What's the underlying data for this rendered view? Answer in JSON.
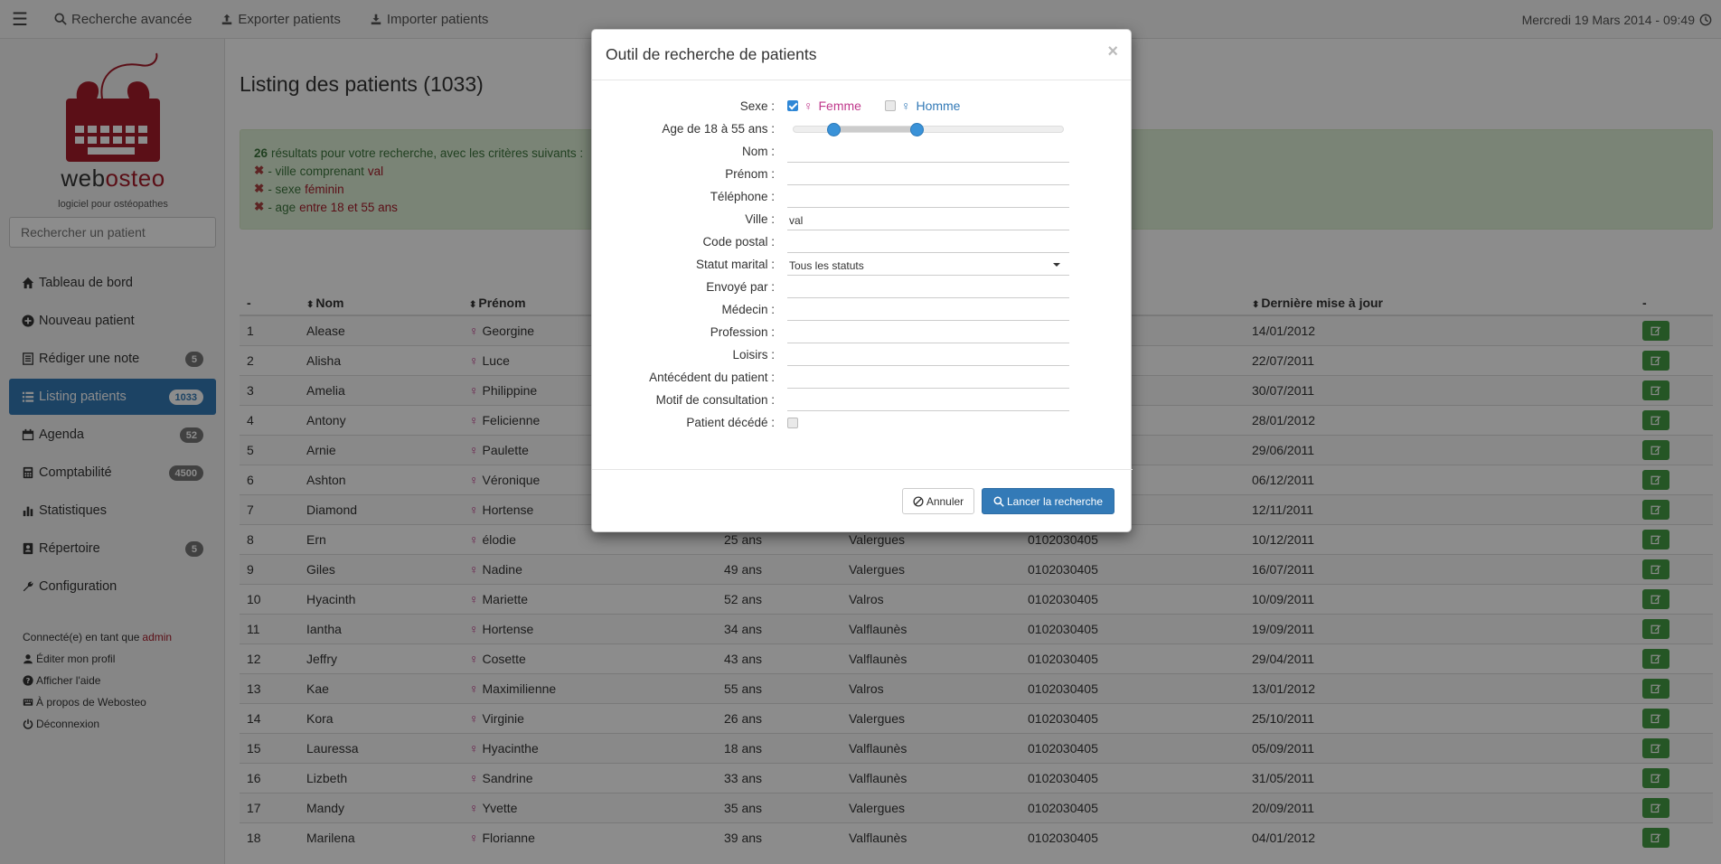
{
  "topbar": {
    "advanced_search": "Recherche avancée",
    "export": "Exporter patients",
    "import": "Importer patients",
    "datetime": "Mercredi 19 Mars 2014 - 09:49"
  },
  "sidebar": {
    "brand_left": "web",
    "brand_right": "osteo",
    "tagline": "logiciel pour ostéopathes",
    "search_placeholder": "Rechercher un patient",
    "items": [
      {
        "label": "Tableau de bord",
        "badge": ""
      },
      {
        "label": "Nouveau patient",
        "badge": ""
      },
      {
        "label": "Rédiger une note",
        "badge": "5"
      },
      {
        "label": "Listing patients",
        "badge": "1033"
      },
      {
        "label": "Agenda",
        "badge": "52"
      },
      {
        "label": "Comptabilité",
        "badge": "4500"
      },
      {
        "label": "Statistiques",
        "badge": ""
      },
      {
        "label": "Répertoire",
        "badge": "5"
      },
      {
        "label": "Configuration",
        "badge": ""
      }
    ],
    "account": {
      "connected_as": "Connecté(e) en tant que",
      "user": "admin",
      "edit_profile": "Éditer mon profil",
      "help": "Afficher l'aide",
      "about": "À propos de Webosteo",
      "logout": "Déconnexion"
    }
  },
  "main": {
    "title": "Listing des patients (1033)",
    "alert": {
      "count": "26",
      "intro": "résultats pour votre recherche, avec les critères suivants :",
      "criteria": [
        {
          "prefix": "- ville comprenant",
          "value": "val"
        },
        {
          "prefix": "- sexe",
          "value": "féminin"
        },
        {
          "prefix": "- age",
          "value": "entre 18 et 55 ans"
        }
      ]
    },
    "columns": [
      "-",
      "Nom",
      "Prénom",
      "Dernière mise à jour",
      "-"
    ],
    "rows": [
      {
        "n": "1",
        "nom": "Alease",
        "prenom": "Georgine",
        "age": "",
        "ville": "",
        "tel": "",
        "maj": "14/01/2012"
      },
      {
        "n": "2",
        "nom": "Alisha",
        "prenom": "Luce",
        "age": "",
        "ville": "",
        "tel": "",
        "maj": "22/07/2011"
      },
      {
        "n": "3",
        "nom": "Amelia",
        "prenom": "Philippine",
        "age": "",
        "ville": "",
        "tel": "",
        "maj": "30/07/2011"
      },
      {
        "n": "4",
        "nom": "Antony",
        "prenom": "Felicienne",
        "age": "",
        "ville": "",
        "tel": "",
        "maj": "28/01/2012"
      },
      {
        "n": "5",
        "nom": "Arnie",
        "prenom": "Paulette",
        "age": "",
        "ville": "",
        "tel": "",
        "maj": "29/06/2011"
      },
      {
        "n": "6",
        "nom": "Ashton",
        "prenom": "Véronique",
        "age": "",
        "ville": "",
        "tel": "",
        "maj": "06/12/2011"
      },
      {
        "n": "7",
        "nom": "Diamond",
        "prenom": "Hortense",
        "age": "",
        "ville": "",
        "tel": "",
        "maj": "12/11/2011"
      },
      {
        "n": "8",
        "nom": "Ern",
        "prenom": "élodie",
        "age": "25 ans",
        "ville": "Valergues",
        "tel": "0102030405",
        "maj": "10/12/2011"
      },
      {
        "n": "9",
        "nom": "Giles",
        "prenom": "Nadine",
        "age": "49 ans",
        "ville": "Valergues",
        "tel": "0102030405",
        "maj": "16/07/2011"
      },
      {
        "n": "10",
        "nom": "Hyacinth",
        "prenom": "Mariette",
        "age": "52 ans",
        "ville": "Valros",
        "tel": "0102030405",
        "maj": "10/09/2011"
      },
      {
        "n": "11",
        "nom": "Iantha",
        "prenom": "Hortense",
        "age": "34 ans",
        "ville": "Valflaunès",
        "tel": "0102030405",
        "maj": "19/09/2011"
      },
      {
        "n": "12",
        "nom": "Jeffry",
        "prenom": "Cosette",
        "age": "43 ans",
        "ville": "Valflaunès",
        "tel": "0102030405",
        "maj": "29/04/2011"
      },
      {
        "n": "13",
        "nom": "Kae",
        "prenom": "Maximilienne",
        "age": "55 ans",
        "ville": "Valros",
        "tel": "0102030405",
        "maj": "13/01/2012"
      },
      {
        "n": "14",
        "nom": "Kora",
        "prenom": "Virginie",
        "age": "26 ans",
        "ville": "Valergues",
        "tel": "0102030405",
        "maj": "25/10/2011"
      },
      {
        "n": "15",
        "nom": "Lauressa",
        "prenom": "Hyacinthe",
        "age": "18 ans",
        "ville": "Valflaunès",
        "tel": "0102030405",
        "maj": "05/09/2011"
      },
      {
        "n": "16",
        "nom": "Lizbeth",
        "prenom": "Sandrine",
        "age": "33 ans",
        "ville": "Valflaunès",
        "tel": "0102030405",
        "maj": "31/05/2011"
      },
      {
        "n": "17",
        "nom": "Mandy",
        "prenom": "Yvette",
        "age": "35 ans",
        "ville": "Valergues",
        "tel": "0102030405",
        "maj": "20/09/2011"
      },
      {
        "n": "18",
        "nom": "Marilena",
        "prenom": "Florianne",
        "age": "39 ans",
        "ville": "Valflaunès",
        "tel": "0102030405",
        "maj": "04/01/2012"
      }
    ]
  },
  "modal": {
    "title": "Outil de recherche de patients",
    "close": "×",
    "sexe_label": "Sexe :",
    "femme": "Femme",
    "homme": "Homme",
    "age_label": "Age de 18 à 55 ans :",
    "age_min": 18,
    "age_max": 55,
    "fields": [
      {
        "label": "Nom :",
        "value": ""
      },
      {
        "label": "Prénom :",
        "value": ""
      },
      {
        "label": "Téléphone :",
        "value": ""
      },
      {
        "label": "Ville :",
        "value": "val"
      },
      {
        "label": "Code postal :",
        "value": ""
      },
      {
        "label": "Statut marital :",
        "value": "Tous les statuts"
      },
      {
        "label": "Envoyé par :",
        "value": ""
      },
      {
        "label": "Médecin :",
        "value": ""
      },
      {
        "label": "Profession :",
        "value": ""
      },
      {
        "label": "Loisirs :",
        "value": ""
      },
      {
        "label": "Antécédent du patient :",
        "value": ""
      },
      {
        "label": "Motif de consultation :",
        "value": ""
      }
    ],
    "deceased_label": "Patient décédé :",
    "cancel": "Annuler",
    "search": "Lancer la recherche"
  },
  "colors": {
    "primary": "#337ab7",
    "success": "#449d44",
    "brand_red": "#a61d2a",
    "female": "#c0398c"
  }
}
